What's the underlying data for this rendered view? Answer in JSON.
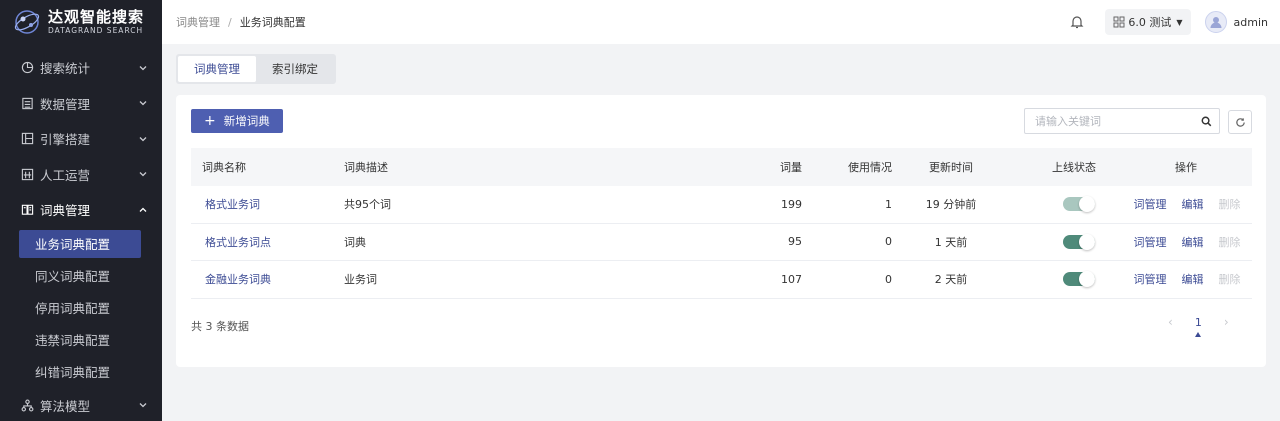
{
  "brand": {
    "name": "达观智能搜索",
    "sub": "DATAGRAND SEARCH"
  },
  "sidebar": {
    "items": [
      {
        "label": "搜索统计",
        "icon": "chart-pie-icon"
      },
      {
        "label": "数据管理",
        "icon": "list-icon"
      },
      {
        "label": "引擎搭建",
        "icon": "layout-icon"
      },
      {
        "label": "人工运营",
        "icon": "grid-icon"
      },
      {
        "label": "词典管理",
        "icon": "book-icon"
      }
    ],
    "submenu": [
      {
        "label": "业务词典配置",
        "active": true
      },
      {
        "label": "同义词典配置"
      },
      {
        "label": "停用词典配置"
      },
      {
        "label": "违禁词典配置"
      },
      {
        "label": "纠错词典配置"
      }
    ],
    "last_item": {
      "label": "算法模型",
      "icon": "network-icon"
    }
  },
  "header": {
    "breadcrumb": [
      "词典管理",
      "业务词典配置"
    ],
    "env_label": "6.0 测试",
    "username": "admin"
  },
  "tabs": [
    "词典管理",
    "索引绑定"
  ],
  "toolbar": {
    "add_label": "新增词典",
    "search_placeholder": "请输入关键词"
  },
  "table": {
    "headers": [
      "词典名称",
      "词典描述",
      "词量",
      "使用情况",
      "更新时间",
      "上线状态",
      "操作"
    ],
    "rows": [
      {
        "name": "格式业务词",
        "desc": "共95个词",
        "count": "199",
        "usage": "1",
        "updated": "19 分钟前",
        "online": true,
        "switch_disabled": true
      },
      {
        "name": "格式业务词点",
        "desc": "词典",
        "count": "95",
        "usage": "0",
        "updated": "1 天前",
        "online": true,
        "switch_disabled": false
      },
      {
        "name": "金融业务词典",
        "desc": "业务词",
        "count": "107",
        "usage": "0",
        "updated": "2 天前",
        "online": true,
        "switch_disabled": false
      }
    ],
    "actions": {
      "manage": "词管理",
      "edit": "编辑",
      "delete": "删除"
    }
  },
  "footer": {
    "count_text": "共 3 条数据",
    "page": "1",
    "prev": "‹",
    "next": "›"
  },
  "colors": {
    "accent": "#3c4b94",
    "sidebar_bg": "#1f2129",
    "switch_on": "#4f8a7a"
  }
}
